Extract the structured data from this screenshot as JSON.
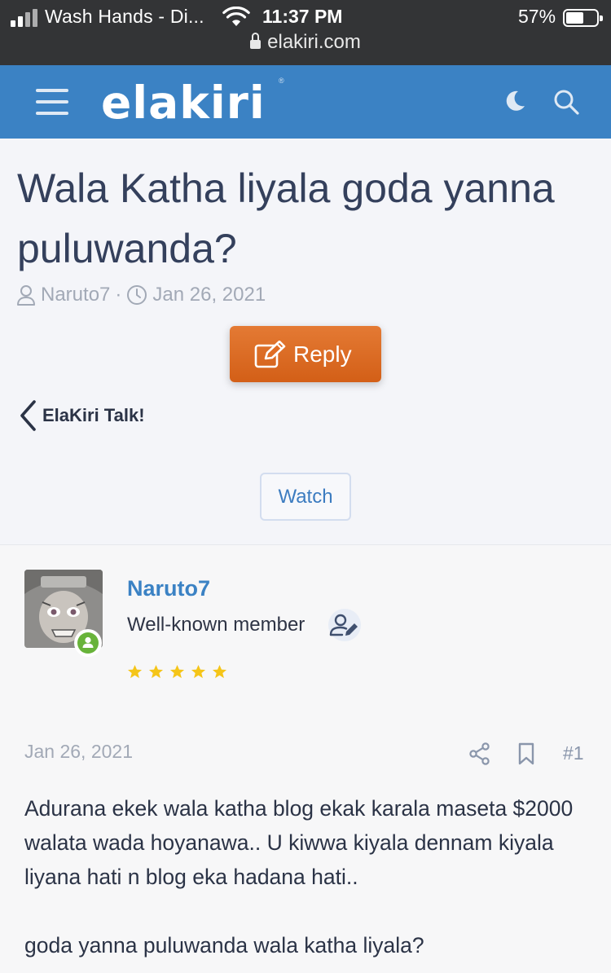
{
  "status_bar": {
    "carrier": "Wash Hands - Di...",
    "time": "11:37 PM",
    "battery_percent": "57%",
    "battery_level": 0.57,
    "url": "elakiri.com"
  },
  "header": {
    "logo": "elakiri",
    "menu_icon": "hamburger-menu-icon",
    "theme_icon": "moon-icon",
    "search_icon": "search-icon",
    "bg_color": "#3b82c4"
  },
  "thread": {
    "title": "Wala Katha liyala goda yanna puluwanda?",
    "author": "Naruto7",
    "separator": "·",
    "date": "Jan 26, 2021",
    "reply_label": "Reply",
    "back_label": "ElaKiri Talk!",
    "watch_label": "Watch"
  },
  "post": {
    "username": "Naruto7",
    "user_title": "Well-known member",
    "stars": 5,
    "date": "Jan 26, 2021",
    "number": "#1",
    "body": [
      "Adurana ekek wala katha blog ekak karala maseta $2000 walata wada hoyanawa.. U kiwwa kiyala dennam kiyala liyana hati n blog eka hadana hati..",
      "goda yanna puluwanda wala katha liyala?"
    ]
  },
  "colors": {
    "accent": "#3b82c4",
    "reply_button": "#d9671f",
    "online": "#68b33a",
    "star": "#f5c518"
  }
}
